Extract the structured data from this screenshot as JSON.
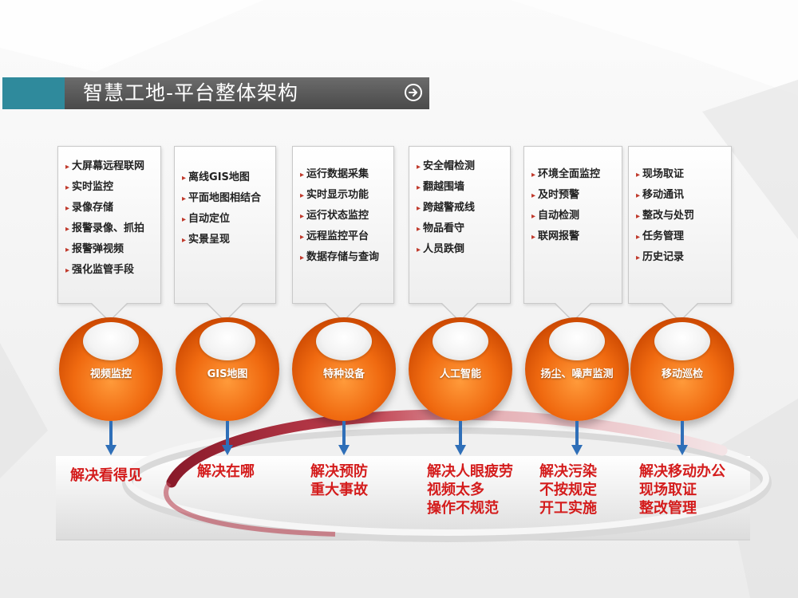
{
  "header": {
    "title": "智慧工地-平台整体架构",
    "accent_color": "#2f8a9c",
    "bar_color": "#555555",
    "arrow_icon": "arrow-right-circle-icon"
  },
  "modules": [
    {
      "name": "视频监控",
      "features": [
        "大屏幕远程联网",
        "实时监控",
        "录像存储",
        "报警录像、抓拍",
        "报警弹视频",
        "强化监管手段"
      ],
      "result": [
        "解决看得见"
      ]
    },
    {
      "name": "GIS地图",
      "features": [
        "离线GIS地图",
        "平面地图相结合",
        "自动定位",
        "实景呈现"
      ],
      "result": [
        "解决在哪"
      ]
    },
    {
      "name": "特种设备",
      "features": [
        "运行数据采集",
        "实时显示功能",
        "运行状态监控",
        "远程监控平台",
        "数据存储与查询"
      ],
      "result": [
        "解决预防",
        "重大事故"
      ]
    },
    {
      "name": "人工智能",
      "features": [
        "安全帽检测",
        "翻越围墙",
        "跨越警戒线",
        "物品看守",
        "人员跌倒"
      ],
      "result": [
        "解决人眼疲劳",
        "视频太多",
        "操作不规范"
      ]
    },
    {
      "name": "扬尘、噪声监测",
      "features": [
        "环境全面监控",
        "及时预警",
        "自动检测",
        "联网报警"
      ],
      "result": [
        "解决污染",
        "不按规定",
        "开工实施"
      ]
    },
    {
      "name": "移动巡检",
      "features": [
        "现场取证",
        "移动通讯",
        "整改与处罚",
        "任务管理",
        "历史记录"
      ],
      "result": [
        "解决移动办公",
        "现场取证",
        "整改管理"
      ]
    }
  ],
  "colors": {
    "sphere": "#f06a10",
    "result_text": "#d41c1c",
    "arrow": "#2f6fb8",
    "bullet": "#c0392b"
  }
}
